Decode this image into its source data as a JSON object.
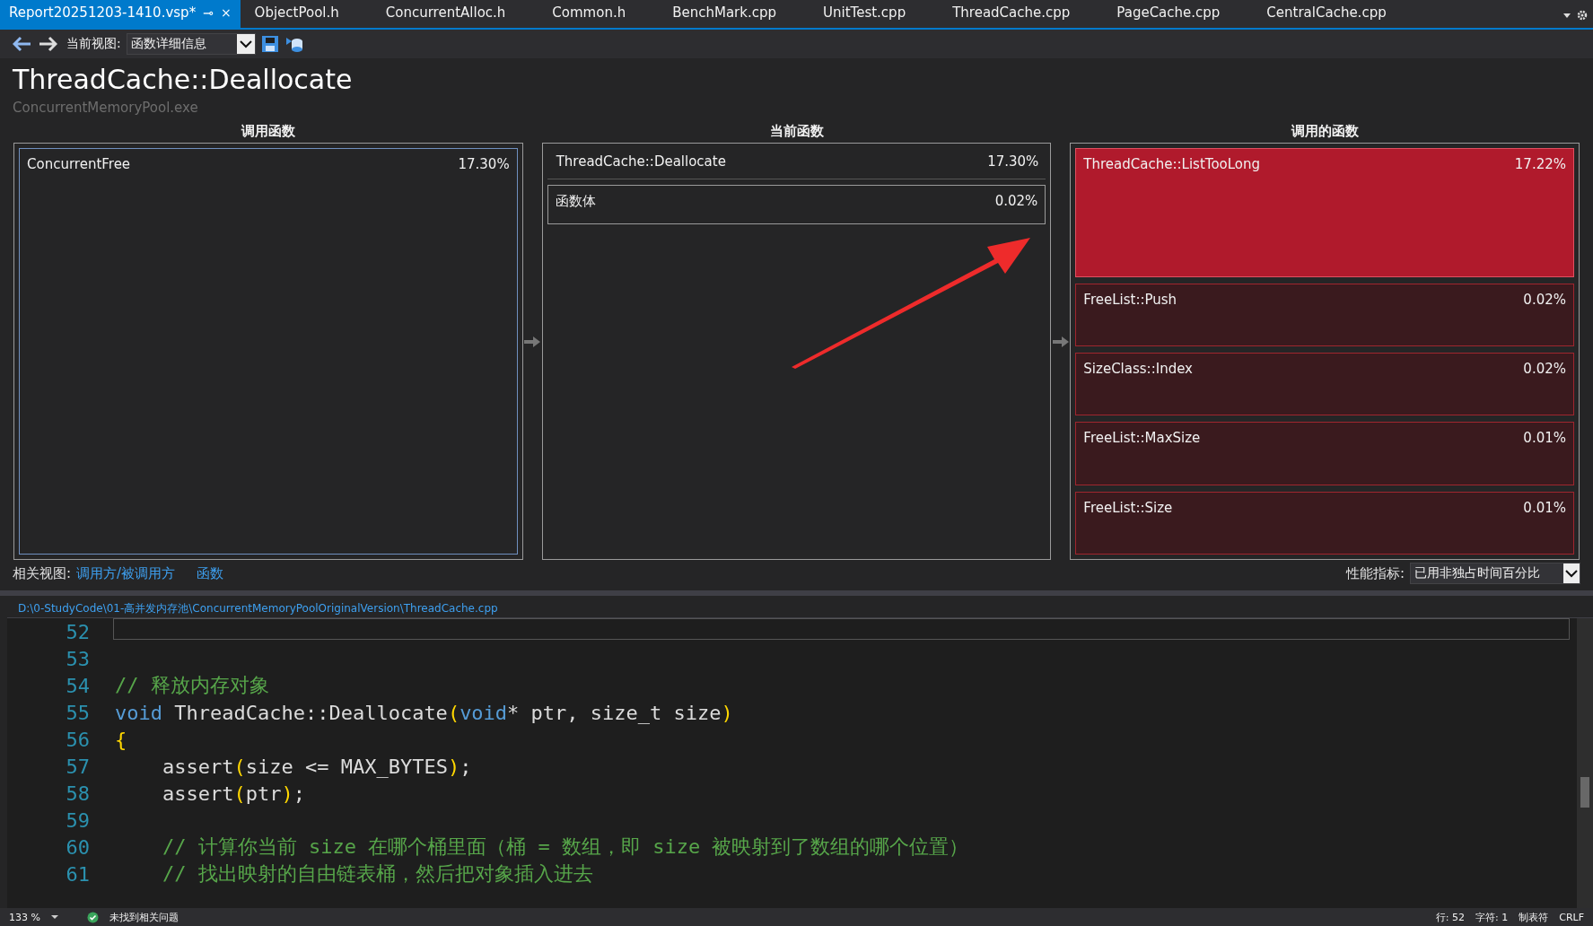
{
  "tabs": [
    {
      "label": "Report20251203-1410.vsp*",
      "selected": true,
      "pin": "⊸",
      "close": "×"
    },
    {
      "label": "ObjectPool.h",
      "selected": false
    },
    {
      "label": "ConcurrentAlloc.h",
      "selected": false
    },
    {
      "label": "Common.h",
      "selected": false
    },
    {
      "label": "BenchMark.cpp",
      "selected": false
    },
    {
      "label": "UnitTest.cpp",
      "selected": false
    },
    {
      "label": "ThreadCache.cpp",
      "selected": false
    },
    {
      "label": "PageCache.cpp",
      "selected": false
    },
    {
      "label": "CentralCache.cpp",
      "selected": false
    }
  ],
  "toolbar": {
    "view_label": "当前视图:",
    "view_value": "函数详细信息"
  },
  "title": "ThreadCache::Deallocate",
  "subtitle": "ConcurrentMemoryPool.exe",
  "callers": {
    "heading": "调用函数",
    "items": [
      {
        "name": "ConcurrentFree",
        "percent": "17.30%"
      }
    ]
  },
  "current": {
    "heading": "当前函数",
    "name": "ThreadCache::Deallocate",
    "percent": "17.30%",
    "body": [
      {
        "name": "函数体",
        "percent": "0.02%"
      }
    ]
  },
  "callees": {
    "heading": "调用的函数",
    "items": [
      {
        "name": "ThreadCache::ListTooLong",
        "percent": "17.22%",
        "hot": true
      },
      {
        "name": "FreeList::Push",
        "percent": "0.02%",
        "hot": false
      },
      {
        "name": "SizeClass::Index",
        "percent": "0.02%",
        "hot": false
      },
      {
        "name": "FreeList::MaxSize",
        "percent": "0.01%",
        "hot": false
      },
      {
        "name": "FreeList::Size",
        "percent": "0.01%",
        "hot": false
      }
    ]
  },
  "related": {
    "label": "相关视图:",
    "links": [
      "调用方/被调用方",
      "函数"
    ]
  },
  "metric": {
    "label": "性能指标:",
    "value": "已用非独占时间百分比"
  },
  "file_path": "D:\\0-StudyCode\\01-高并发内存池\\ConcurrentMemoryPoolOriginalVersion\\ThreadCache.cpp",
  "code": [
    {
      "number": "52"
    },
    {
      "number": "53"
    },
    {
      "number": "54",
      "tokens": [
        {
          "kind": "comment",
          "text": "// 释放内存对象"
        }
      ]
    },
    {
      "number": "55",
      "tokens": [
        {
          "kind": "keyword",
          "text": "void"
        },
        {
          "kind": "plain",
          "text": " ThreadCache::Deallocate"
        },
        {
          "kind": "paren",
          "text": "("
        },
        {
          "kind": "keyword",
          "text": "void"
        },
        {
          "kind": "plain",
          "text": "* ptr, size_t size"
        },
        {
          "kind": "paren",
          "text": ")"
        }
      ]
    },
    {
      "number": "56",
      "tokens": [
        {
          "kind": "paren",
          "text": "{"
        }
      ]
    },
    {
      "number": "57",
      "tokens": [
        {
          "kind": "plain",
          "text": "    assert"
        },
        {
          "kind": "paren",
          "text": "("
        },
        {
          "kind": "plain",
          "text": "size <= MAX_BYTES"
        },
        {
          "kind": "paren",
          "text": ")"
        },
        {
          "kind": "plain",
          "text": ";"
        }
      ]
    },
    {
      "number": "58",
      "tokens": [
        {
          "kind": "plain",
          "text": "    assert"
        },
        {
          "kind": "paren",
          "text": "("
        },
        {
          "kind": "plain",
          "text": "ptr"
        },
        {
          "kind": "paren",
          "text": ")"
        },
        {
          "kind": "plain",
          "text": ";"
        }
      ]
    },
    {
      "number": "59"
    },
    {
      "number": "60",
      "tokens": [
        {
          "kind": "comment",
          "text": "    // 计算你当前 size 在哪个桶里面（桶 = 数组，即 size 被映射到了数组的哪个位置）"
        }
      ]
    },
    {
      "number": "61",
      "tokens": [
        {
          "kind": "comment",
          "text": "    // 找出映射的自由链表桶，然后把对象插入进去"
        }
      ]
    }
  ],
  "status": {
    "zoom": "133 %",
    "issues": "未找到相关问题",
    "line": "行: 52",
    "char": "字符: 1",
    "tabs": "制表符",
    "eol": "CRLF"
  }
}
